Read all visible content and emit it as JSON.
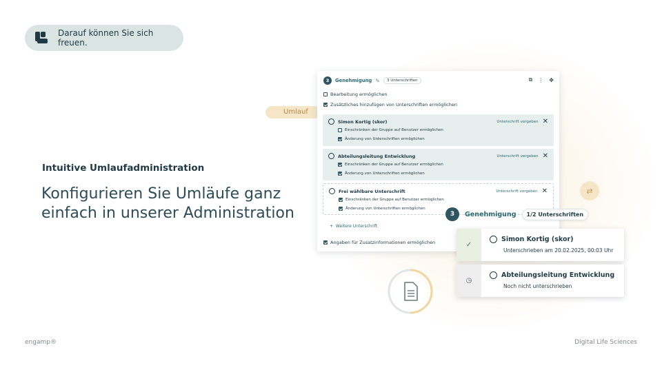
{
  "pill": {
    "text": "Darauf können Sie sich freuen."
  },
  "headline": "Intuitive Umlaufadministration",
  "subline": "Konfigurieren Sie Umläufe ganz einfach in unserer Administration",
  "umlauf_tag": "Umlauf",
  "card": {
    "step": "3",
    "title": "Genehmigung",
    "badge": "3 Unterschriften",
    "opt_edit": "Bearbeitung ermöglichen",
    "opt_add": "Zusätzliches hinzufügen von Unterschriften ermöglichen",
    "groups": [
      {
        "name": "Simon Kortig (skor)",
        "action": "Unterschrift vorgeben",
        "s1": "Einschränken der Gruppe auf Benutzer ermöglichen",
        "s2": "Änderung von Unterschriften ermöglichen"
      },
      {
        "name": "Abteilungsleitung Entwicklung",
        "action": "Unterschrift vorgeben",
        "s1": "Einschränken der Gruppe auf Benutzer ermöglichen",
        "s2": "Änderung von Unterschriften ermöglichen"
      },
      {
        "name": "Frei wählbare Unterschrift",
        "action": "Unterschrift vorgeben",
        "s1": "Einschränken der Gruppe auf Benutzer ermöglichen",
        "s2": "Änderung von Unterschriften ermöglichen"
      }
    ],
    "more": "Weitere Unterschrift",
    "opt_info": "Angaben für Zusatzinformationen ermöglichen"
  },
  "overlay": {
    "step": "3",
    "title": "Genehmigung",
    "badge": "1/2 Unterschriften",
    "signers": [
      {
        "name": "Simon Kortig (skor)",
        "info": "Unterschrieben am 20.02.2025, 00:03 Uhr",
        "status_icon": "check-icon",
        "color": "#e9f0e2"
      },
      {
        "name": "Abteilungsleitung Entwicklung",
        "info": "Noch nicht unterschrieben",
        "status_icon": "clock-icon",
        "color": "#eeeeee"
      }
    ]
  },
  "footer": {
    "left": "engamp®",
    "right": "Digital Life Sciences"
  },
  "colors": {
    "primary": "#2e5560",
    "accent": "#2e6a73",
    "pill": "#d9e4e3",
    "gold": "#f0d7a0"
  }
}
